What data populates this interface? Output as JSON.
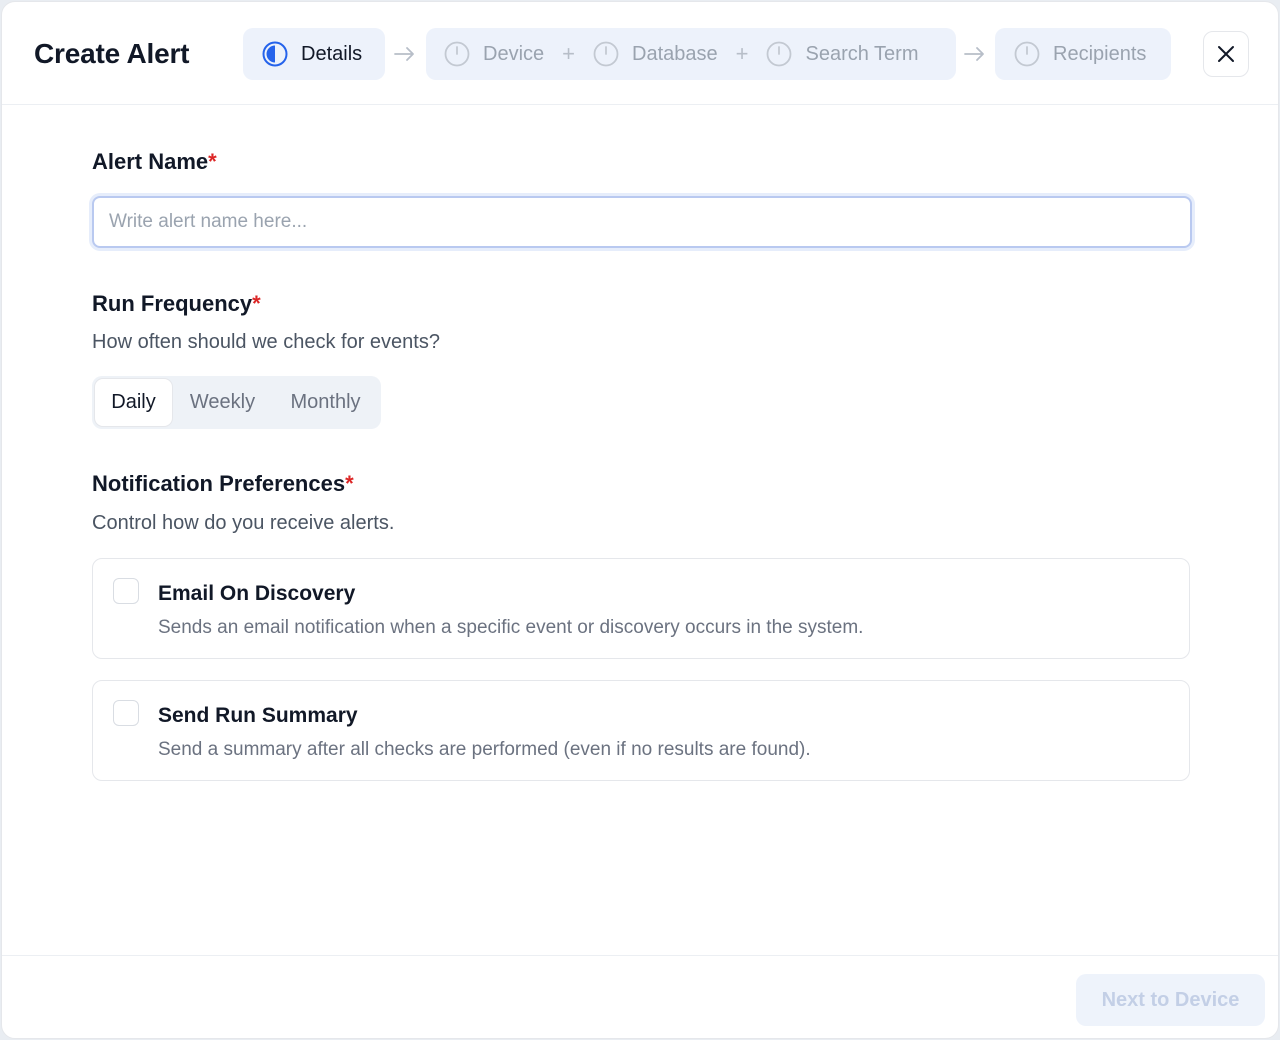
{
  "header": {
    "title": "Create Alert",
    "close_icon": "close-icon"
  },
  "stepper": {
    "steps": [
      {
        "label": "Details",
        "state": "active"
      },
      {
        "label": "Device",
        "state": "inactive"
      },
      {
        "label": "Database",
        "state": "inactive"
      },
      {
        "label": "Search Term",
        "state": "inactive"
      },
      {
        "label": "Recipients",
        "state": "inactive"
      }
    ],
    "plus_sign": "+"
  },
  "alert_name": {
    "label": "Alert Name",
    "required_mark": "*",
    "placeholder": "Write alert name here...",
    "value": ""
  },
  "run_frequency": {
    "label": "Run Frequency",
    "required_mark": "*",
    "helper": "How often should we check for events?",
    "options": [
      "Daily",
      "Weekly",
      "Monthly"
    ],
    "selected": "Daily"
  },
  "notifications": {
    "label": "Notification Preferences",
    "required_mark": "*",
    "helper": "Control how do you receive alerts.",
    "options": [
      {
        "title": "Email On Discovery",
        "description": "Sends an email notification when a specific event or discovery occurs in the system.",
        "checked": false
      },
      {
        "title": "Send Run Summary",
        "description": "Send a summary after all checks are performed (even if no results are found).",
        "checked": false
      }
    ]
  },
  "footer": {
    "next_label": "Next to Device"
  },
  "colors": {
    "accent": "#2563eb",
    "required": "#dc2626",
    "step_bg": "#edf2fb",
    "muted_text": "#9aa3af"
  }
}
